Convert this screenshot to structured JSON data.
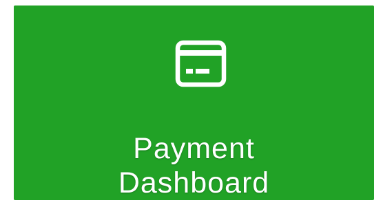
{
  "tile": {
    "label_line1": "Payment",
    "label_line2": "Dashboard",
    "icon": "credit-card-icon",
    "background_color": "#21a226",
    "text_color": "#ffffff"
  }
}
